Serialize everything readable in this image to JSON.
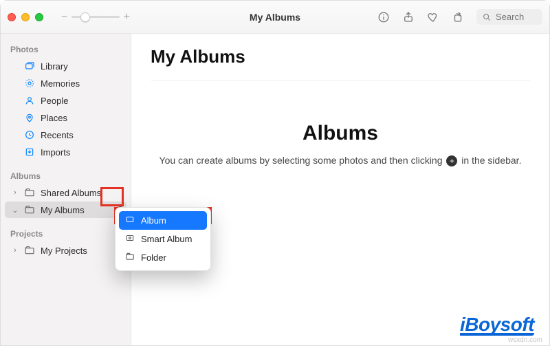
{
  "window": {
    "title": "My Albums"
  },
  "toolbar": {
    "search_placeholder": "Search"
  },
  "sidebar": {
    "sections": {
      "photos": {
        "title": "Photos",
        "items": [
          {
            "label": "Library",
            "icon": "photo-stack-icon"
          },
          {
            "label": "Memories",
            "icon": "memories-icon"
          },
          {
            "label": "People",
            "icon": "people-icon"
          },
          {
            "label": "Places",
            "icon": "places-icon"
          },
          {
            "label": "Recents",
            "icon": "clock-icon"
          },
          {
            "label": "Imports",
            "icon": "import-icon"
          }
        ]
      },
      "albums": {
        "title": "Albums",
        "items": [
          {
            "label": "Shared Albums",
            "icon": "shared-folder-icon",
            "disclosure": true
          },
          {
            "label": "My Albums",
            "icon": "album-folder-icon",
            "disclosure": true,
            "selected": true,
            "add_button": true
          }
        ]
      },
      "projects": {
        "title": "Projects",
        "items": [
          {
            "label": "My Projects",
            "icon": "projects-folder-icon",
            "disclosure": true
          }
        ]
      }
    }
  },
  "context_menu": {
    "items": [
      {
        "label": "Album",
        "icon": "album-icon",
        "highlighted": true
      },
      {
        "label": "Smart Album",
        "icon": "smart-album-icon",
        "highlighted": false
      },
      {
        "label": "Folder",
        "icon": "folder-icon",
        "highlighted": false
      }
    ]
  },
  "main": {
    "heading": "My Albums",
    "empty_title": "Albums",
    "empty_text_before": "You can create albums by selecting some photos and then clicking ",
    "empty_text_after": " in the sidebar."
  },
  "branding": {
    "watermark": "iBoysoft",
    "site": "wsxdn.com"
  },
  "colors": {
    "accent": "#0a84ff",
    "highlight_red": "#e33223",
    "menu_selection": "#1677ff"
  }
}
